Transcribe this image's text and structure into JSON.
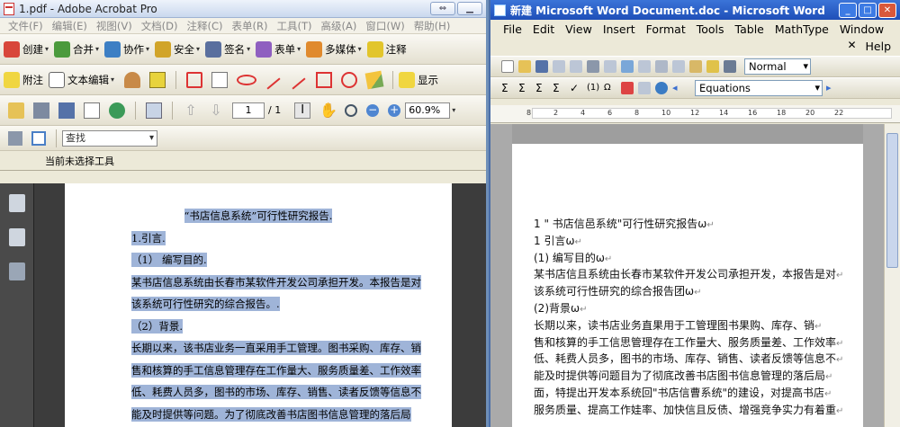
{
  "acrobat": {
    "title": "1.pdf - Adobe Acrobat Pro",
    "menu": [
      "文件(F)",
      "编辑(E)",
      "视图(V)",
      "文档(D)",
      "注释(C)",
      "表单(R)",
      "工具(T)",
      "高级(A)",
      "窗口(W)",
      "帮助(H)"
    ],
    "toolbar1": {
      "create": "创建",
      "merge": "合并",
      "collaborate": "协作",
      "secure": "安全",
      "sign": "签名",
      "forms": "表单",
      "multimedia": "多媒体",
      "comment": "注释"
    },
    "toolbar2": {
      "attach": "附注",
      "text_edit": "文本编辑",
      "show": "显示"
    },
    "toolbar3": {
      "page_current": "1",
      "page_total": "/ 1",
      "zoom": "60.9%"
    },
    "find_placeholder": "查找",
    "status": "当前未选择工具",
    "pdf_lines": [
      "“书店信息系统”可行性研究报告.",
      "1.引言.",
      "（1）  编写目的.",
      "某书店信息系统由长春市某软件开发公司承担开发。本报告是对",
      "该系统可行性研究的综合报告。.",
      "（2）背景.",
      "长期以来，该书店业务一直采用手工管理。图书采购、库存、销",
      "售和核算的手工信息管理存在工作量大、服务质量差、工作效率",
      "低、耗费人员多，图书的市场、库存、销售、读者反馈等信息不",
      "能及时提供等问题。为了彻底改善书店图书信息管理的落后局"
    ]
  },
  "word": {
    "title": "新建 Microsoft Word Document.doc - Microsoft Word",
    "menu": [
      "File",
      "Edit",
      "View",
      "Insert",
      "Format",
      "Tools",
      "Table",
      "MathType",
      "Window",
      "Help"
    ],
    "style_value": "Normal",
    "equations_value": "Equations",
    "doc_lines": [
      "1 \" 书店信邑系统\"可行性研究报告ω",
      "1 引言ω",
      "(1) 编写目的ω",
      "某书店信且系统由长春市某软件开发公司承担开发，本报告是对",
      "该系统可行性研究的综合报告团ω",
      "(2)背景ω",
      "长期以来，读书店业务直果用于工管理图书果购、库存、销",
      "售和核算的手工信思管理存在工作量大、服务质量差、工作效率",
      "低、耗费人员多，图书的市场、库存、销售、读者反馈等信息不",
      "能及时提供等问题目为了彻底改善书店图书信息管理的落后局",
      "面，特提出开发本系统回\"书店信曹系统\"的建设，对提高书店",
      "服务质量、提高工作娃率、加快信且反债、增强竞争实力有着重"
    ]
  },
  "colors": {
    "selection": "#9fb4d8",
    "word_title": "#2a5fc8",
    "acro_bg": "#ece9d8"
  }
}
